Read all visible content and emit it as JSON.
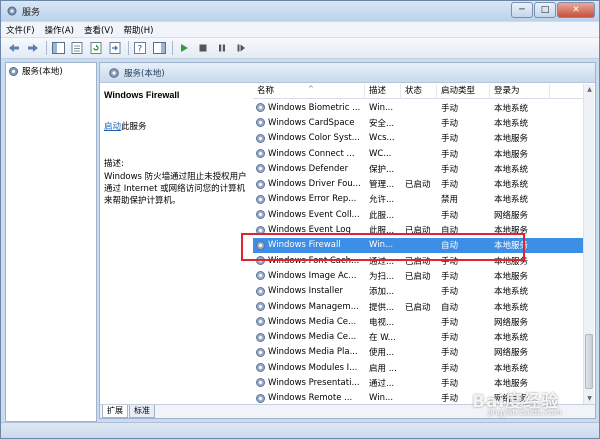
{
  "window": {
    "title": "服务",
    "minimize": "─",
    "maximize": "□",
    "close": "✕"
  },
  "menu": [
    "文件(F)",
    "操作(A)",
    "查看(V)",
    "帮助(H)"
  ],
  "tree": {
    "root": "服务(本地)"
  },
  "pane": {
    "title": "服务(本地)"
  },
  "details": {
    "service_name": "Windows Firewall",
    "start_link": "启动",
    "start_suffix": "此服务",
    "desc_label": "描述:",
    "description": "Windows 防火墙通过阻止未授权用户通过 Internet 或网络访问您的计算机来帮助保护计算机。"
  },
  "columns": {
    "name": "名称",
    "desc": "描述",
    "status": "状态",
    "startup": "启动类型",
    "logon": "登录为"
  },
  "services": [
    {
      "name": "Windows Biometric ...",
      "desc": "Win...",
      "status": "",
      "startup": "手动",
      "logon": "本地系统"
    },
    {
      "name": "Windows CardSpace",
      "desc": "安全...",
      "status": "",
      "startup": "手动",
      "logon": "本地系统"
    },
    {
      "name": "Windows Color Syst...",
      "desc": "Wcs...",
      "status": "",
      "startup": "手动",
      "logon": "本地服务"
    },
    {
      "name": "Windows Connect ...",
      "desc": "WC...",
      "status": "",
      "startup": "手动",
      "logon": "本地服务"
    },
    {
      "name": "Windows Defender",
      "desc": "保护...",
      "status": "",
      "startup": "手动",
      "logon": "本地系统"
    },
    {
      "name": "Windows Driver Fou...",
      "desc": "管理...",
      "status": "已启动",
      "startup": "手动",
      "logon": "本地系统"
    },
    {
      "name": "Windows Error Rep...",
      "desc": "允许...",
      "status": "",
      "startup": "禁用",
      "logon": "本地系统"
    },
    {
      "name": "Windows Event Coll...",
      "desc": "此服...",
      "status": "",
      "startup": "手动",
      "logon": "网络服务"
    },
    {
      "name": "Windows Event Log",
      "desc": "此服...",
      "status": "已启动",
      "startup": "自动",
      "logon": "本地服务"
    },
    {
      "name": "Windows Firewall",
      "desc": "Win...",
      "status": "",
      "startup": "自动",
      "logon": "本地服务",
      "selected": true
    },
    {
      "name": "Windows Font Cach...",
      "desc": "通过...",
      "status": "已启动",
      "startup": "手动",
      "logon": "本地服务"
    },
    {
      "name": "Windows Image Ac...",
      "desc": "为扫...",
      "status": "已启动",
      "startup": "手动",
      "logon": "本地服务"
    },
    {
      "name": "Windows Installer",
      "desc": "添加...",
      "status": "",
      "startup": "手动",
      "logon": "本地系统"
    },
    {
      "name": "Windows Managem...",
      "desc": "提供...",
      "status": "已启动",
      "startup": "自动",
      "logon": "本地系统"
    },
    {
      "name": "Windows Media Ce...",
      "desc": "电视...",
      "status": "",
      "startup": "手动",
      "logon": "网络服务"
    },
    {
      "name": "Windows Media Ce...",
      "desc": "在 W...",
      "status": "",
      "startup": "手动",
      "logon": "本地系统"
    },
    {
      "name": "Windows Media Pla...",
      "desc": "使用...",
      "status": "",
      "startup": "手动",
      "logon": "网络服务"
    },
    {
      "name": "Windows Modules I...",
      "desc": "启用 ...",
      "status": "",
      "startup": "手动",
      "logon": "本地系统"
    },
    {
      "name": "Windows Presentati...",
      "desc": "通过...",
      "status": "",
      "startup": "手动",
      "logon": "本地服务"
    },
    {
      "name": "Windows Remote ...",
      "desc": "Win...",
      "status": "",
      "startup": "手动",
      "logon": "网络服务"
    }
  ],
  "tabs": [
    "扩展",
    "标准"
  ],
  "watermark": {
    "main": "Bai度经验",
    "sub": "jingyan.baidu.com"
  }
}
